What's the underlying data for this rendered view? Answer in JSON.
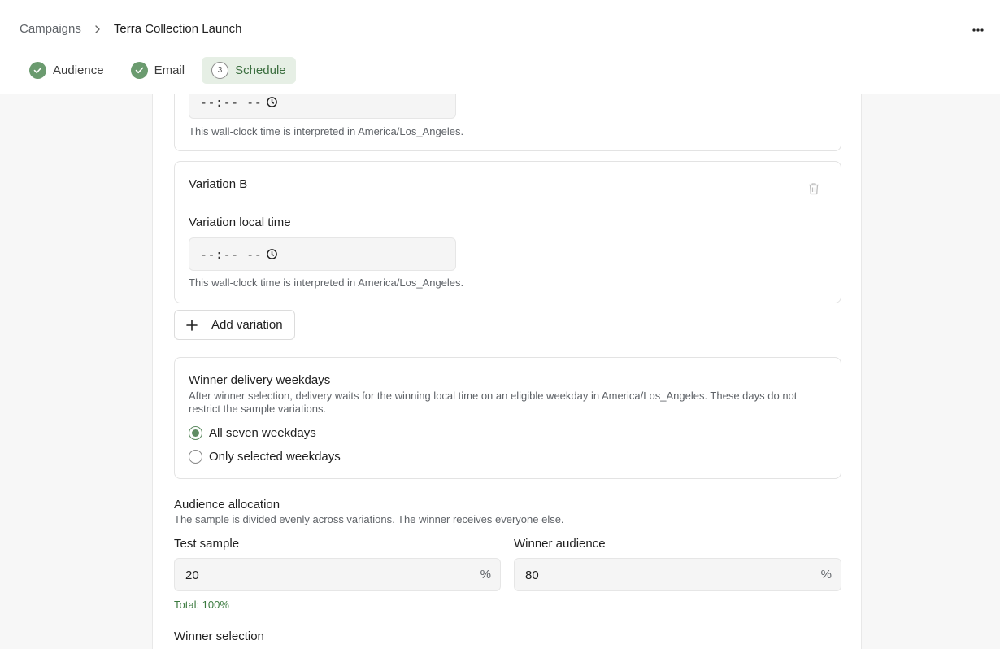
{
  "breadcrumb": {
    "parent": "Campaigns",
    "current": "Terra Collection Launch"
  },
  "steps": [
    {
      "label": "Audience",
      "status": "done"
    },
    {
      "label": "Email",
      "status": "done"
    },
    {
      "label": "Schedule",
      "number": "3",
      "status": "active"
    }
  ],
  "variation_a": {
    "time_placeholder": "--:-- --",
    "hint": "This wall-clock time is interpreted in America/Los_Angeles."
  },
  "variation_b": {
    "title": "Variation B",
    "time_label": "Variation local time",
    "time_placeholder": "--:-- --",
    "hint": "This wall-clock time is interpreted in America/Los_Angeles."
  },
  "add_variation_label": "Add variation",
  "weekdays": {
    "title": "Winner delivery weekdays",
    "description_line1": "After winner selection, delivery waits for the winning local time on an eligible weekday in America/Los_Angeles. These days do not",
    "description_line2": "restrict the sample variations.",
    "options": [
      {
        "label": "All seven weekdays",
        "checked": true
      },
      {
        "label": "Only selected weekdays",
        "checked": false
      }
    ]
  },
  "allocation": {
    "title": "Audience allocation",
    "description": "The sample is divided evenly across variations. The winner receives everyone else.",
    "test_sample_label": "Test sample",
    "test_sample_value": "20",
    "winner_audience_label": "Winner audience",
    "winner_audience_value": "80",
    "unit": "%",
    "total": "Total: 100%"
  },
  "winner_selection_label": "Winner selection",
  "colors": {
    "accent": "#6b9b6f",
    "active_step_bg": "#e6efe5",
    "total_text": "#3b7a3f"
  }
}
